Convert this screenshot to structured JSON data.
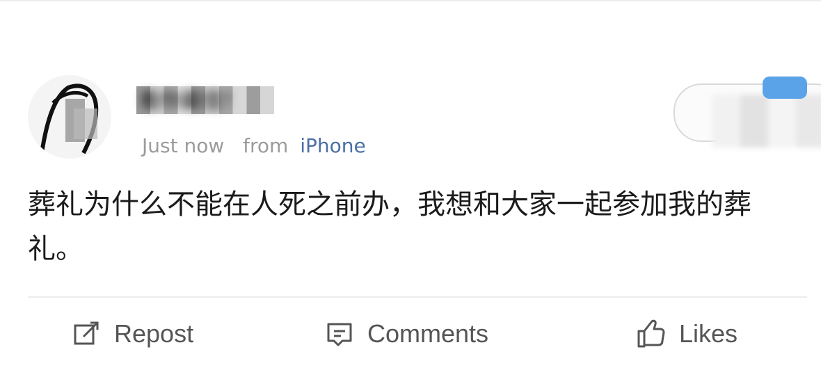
{
  "post": {
    "username": "看你最佳！",
    "time": "Just now",
    "from_label": "from",
    "device": "iPhone",
    "text": "葬礼为什么不能在人死之前办，我想和大家一起参加我的葬礼。"
  },
  "actions": {
    "repost_label": "Repost",
    "comments_label": "Comments",
    "likes_label": "Likes"
  },
  "icons": {
    "repost": "repost-icon",
    "comments": "comments-icon",
    "likes": "like-icon"
  },
  "colors": {
    "link": "#4a6fa5",
    "meta": "#9b9b9b",
    "text": "#1b1b1b",
    "action": "#555555",
    "badge": "#5aa3e8"
  }
}
